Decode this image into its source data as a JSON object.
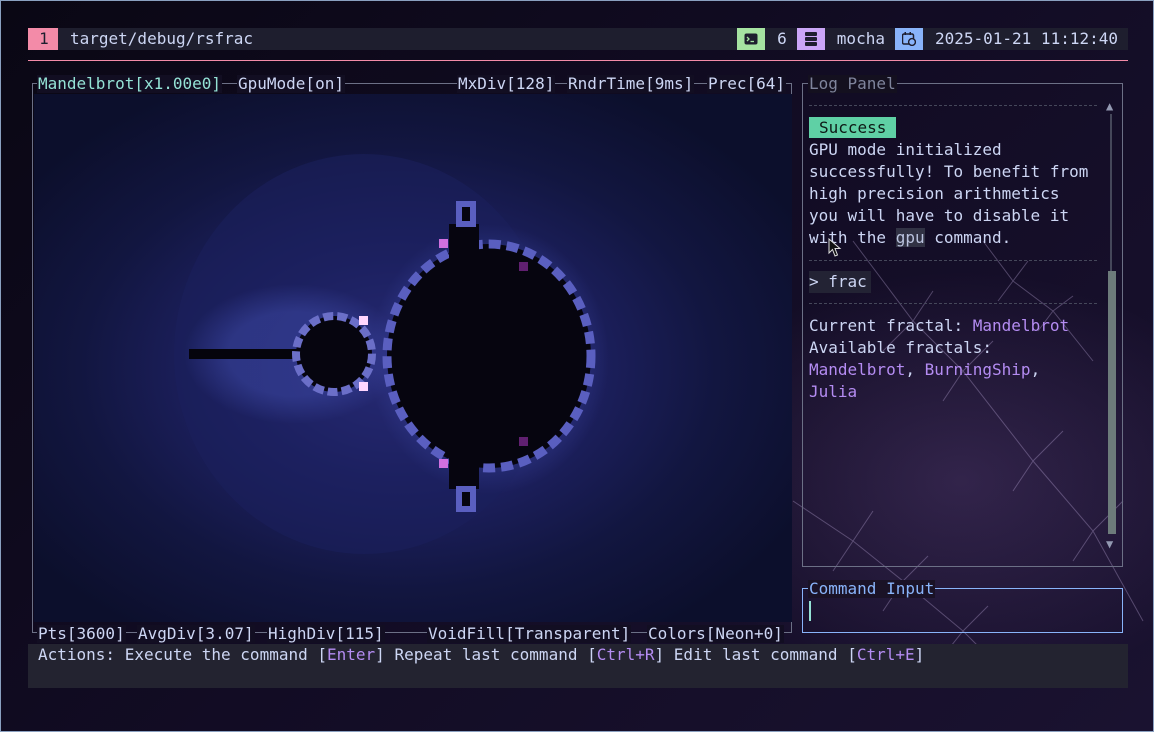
{
  "status_bar": {
    "workspace": "1",
    "window_title": "target/debug/rsfrac",
    "terminal_count": "6",
    "theme": "mocha",
    "datetime": "2025-01-21 11:12:40",
    "colors": {
      "workspace": "#f38ba8",
      "terminal_icon": "#a6e3a1",
      "theme_icon": "#cba6f7",
      "calendar_icon": "#89b4fa"
    }
  },
  "fractal_panel": {
    "top_left": "Mandelbrot[x1.00e0]",
    "gpu_mode": "GpuMode[on]",
    "max_div": "MxDiv[128]",
    "render_time": "RndrTime[9ms]",
    "precision": "Prec[64]",
    "points": "Pts[3600]",
    "avg_div": "AvgDiv[3.07]",
    "high_div": "HighDiv[115]",
    "void_fill": "VoidFill[Transparent]",
    "colors": "Colors[Neon+0]"
  },
  "log_panel": {
    "title": "Log Panel",
    "badge": "Success",
    "message_part1": "GPU mode initialized\nsuccessfully! To benefit from\nhigh precision arithmetics\nyou will have to disable it\nwith the ",
    "message_code": "gpu",
    "message_part2": " command.",
    "prompt": "> frac",
    "current_label": "Current fractal: ",
    "current_value": "Mandelbrot",
    "available_label": "Available fractals:",
    "fractals": [
      "Mandelbrot",
      "BurningShip",
      "Julia"
    ],
    "separator": ", ",
    "comma": ","
  },
  "command_panel": {
    "title": "Command Input",
    "value": ""
  },
  "actions": {
    "prefix": "Actions: ",
    "execute_label": "Execute the command [",
    "execute_key": "Enter",
    "repeat_label": "] Repeat last command [",
    "repeat_key": "Ctrl+R",
    "edit_label": "] Edit last command [",
    "edit_key": "Ctrl+E",
    "suffix": "]"
  }
}
